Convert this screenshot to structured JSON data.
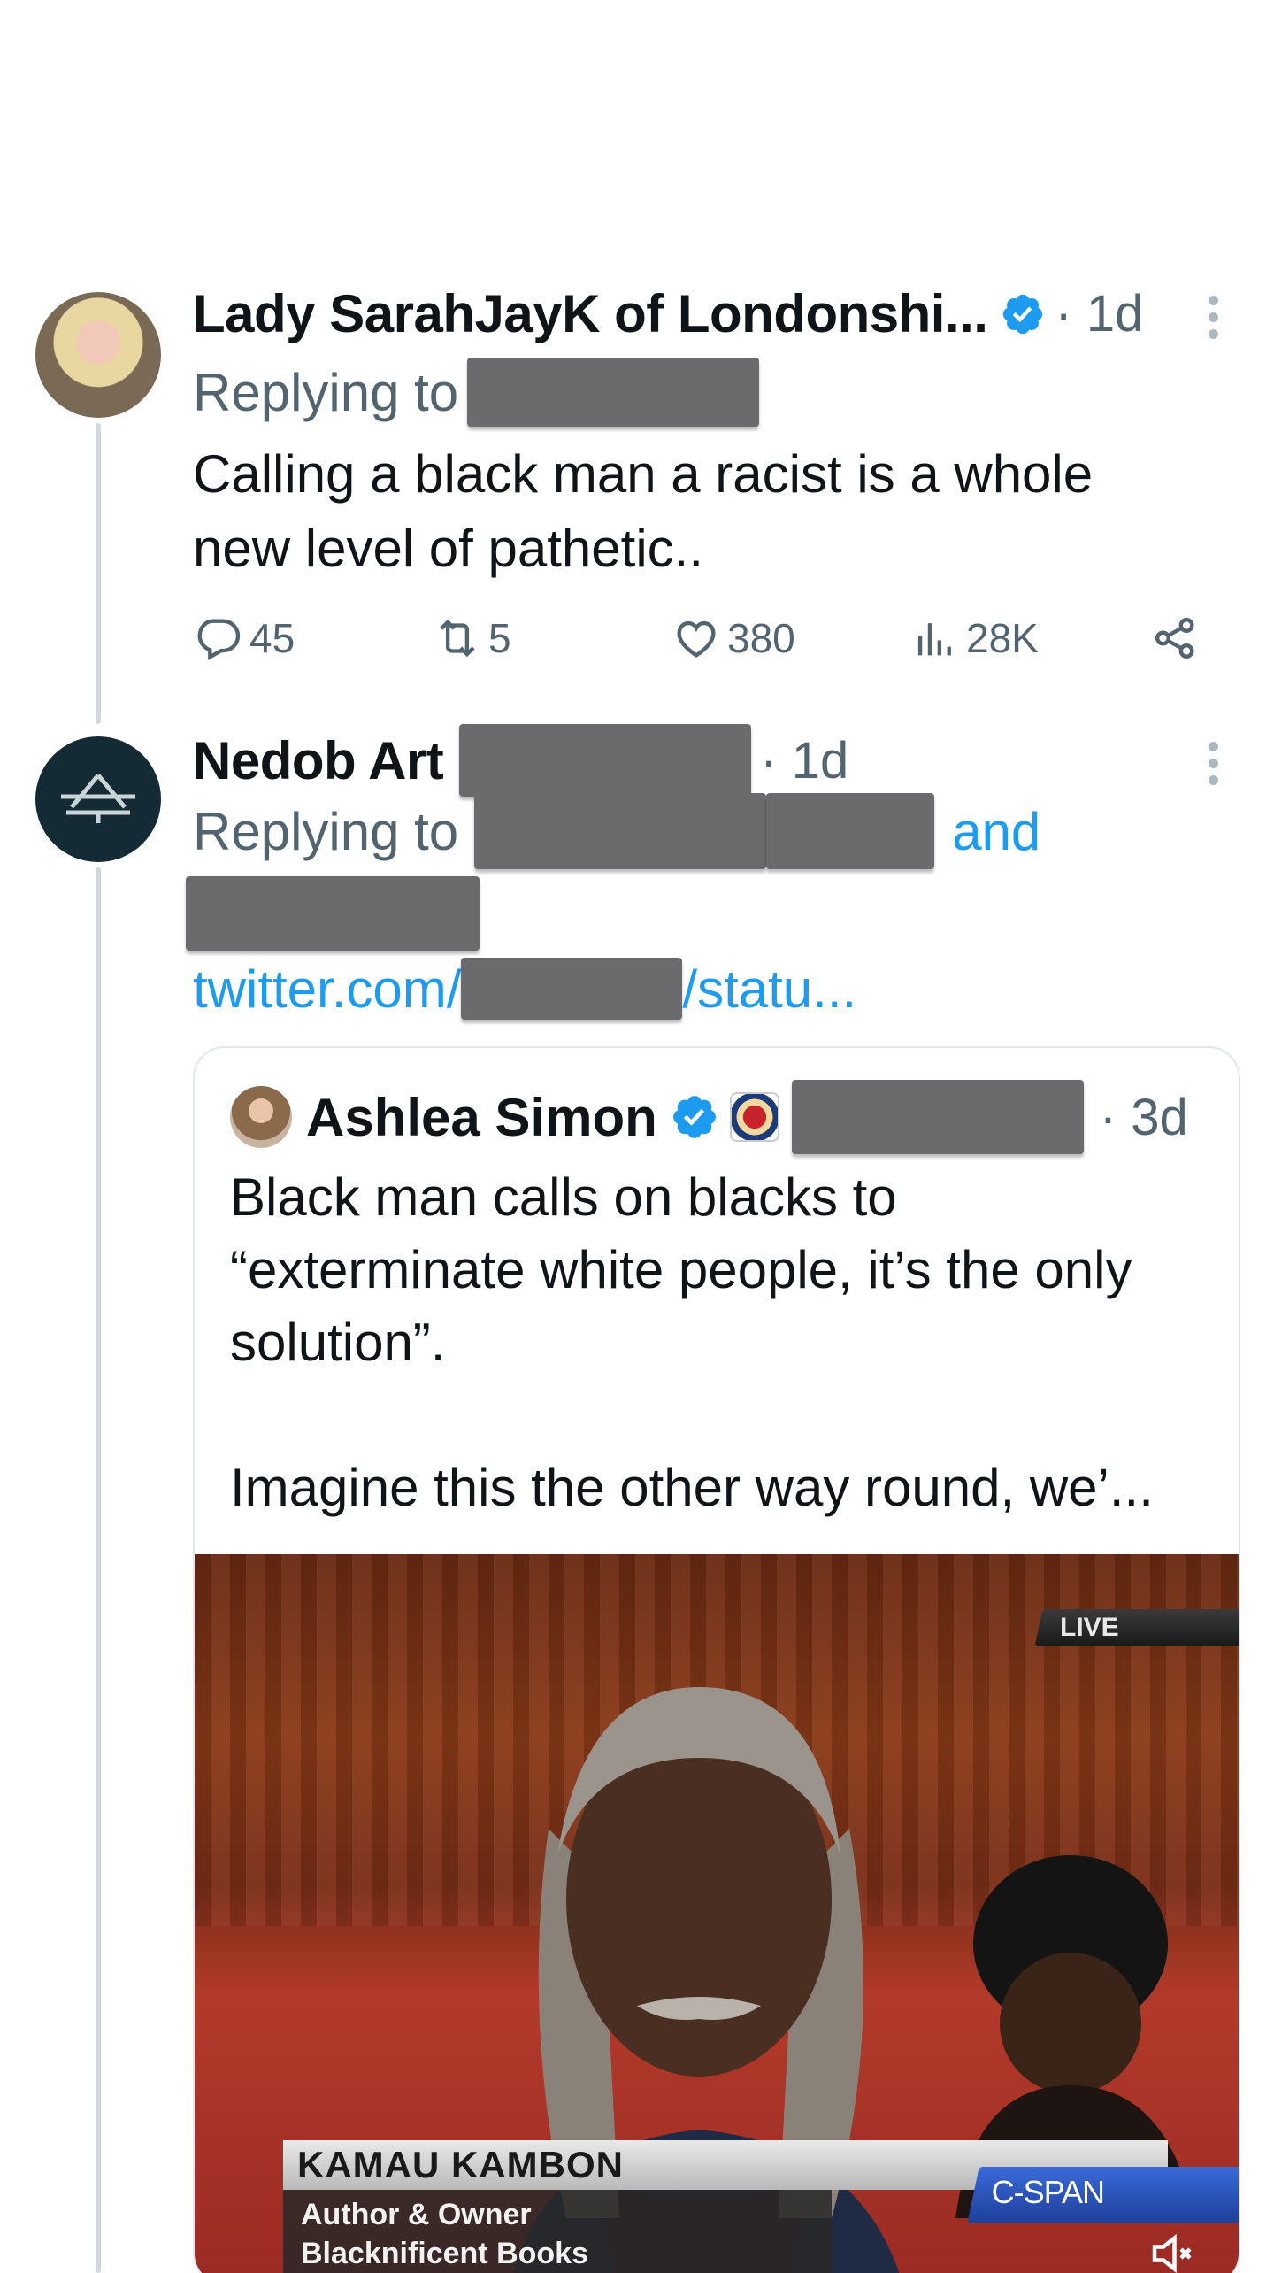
{
  "thread": [
    {
      "display_name": "Lady SarahJayK of Londonshi...",
      "verified": true,
      "time": "· 1d",
      "replying_to_label": "Replying to",
      "text_lines": [
        "Calling a black man a racist is a whole",
        "new level of pathetic.."
      ],
      "actions": {
        "replies": "45",
        "reposts": "5",
        "likes": "380",
        "views": "28K"
      }
    },
    {
      "display_name": "Nedob Art",
      "time": "· 1d",
      "replying_to_label": "Replying to",
      "and_label": "and",
      "link_prefix": "twitter.com/",
      "link_suffix": "/statu...",
      "quote": {
        "display_name": "Ashlea Simon",
        "verified": true,
        "time": "· 3d",
        "text_lines": [
          "Black man calls on blacks to",
          "“exterminate white people, it’s the only",
          "solution”.",
          "",
          "Imagine this the other way round, we’..."
        ],
        "video": {
          "live_label": "LIVE",
          "lower_third_name": "KAMAU KAMBON",
          "lower_third_line1": "Author & Owner",
          "lower_third_line2": "Blacknificent Books",
          "network": "C-SPAN"
        }
      }
    }
  ],
  "colors": {
    "link": "#1d9bf0",
    "secondary_text": "#536471",
    "thread_line": "#cfd9de"
  }
}
